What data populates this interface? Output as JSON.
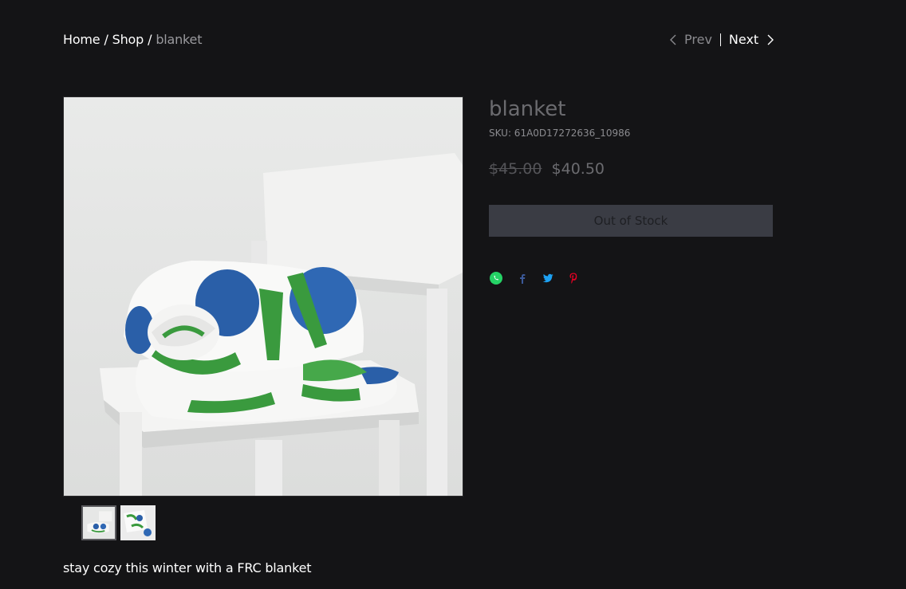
{
  "breadcrumb": {
    "home": "Home",
    "shop": "Shop",
    "current": "blanket",
    "separator": "/"
  },
  "pager": {
    "prev_label": "Prev",
    "next_label": "Next",
    "prev_icon": "chevron-left-icon",
    "next_icon": "chevron-right-icon"
  },
  "product": {
    "title": "blanket",
    "sku": "SKU: 61A0D17272636_10986",
    "original_price": "$45.00",
    "sale_price": "$40.50",
    "stock_button": "Out of Stock",
    "description": "stay cozy this winter with a FRC blanket"
  },
  "share": [
    {
      "name": "whatsapp-icon",
      "color": "#25D366"
    },
    {
      "name": "facebook-icon",
      "color": "#3b5998"
    },
    {
      "name": "twitter-icon",
      "color": "#1DA1F2"
    },
    {
      "name": "pinterest-icon",
      "color": "#E60023"
    }
  ],
  "colors": {
    "background": "#141416",
    "button_bg": "#3a3c44",
    "blanket_green": "#3a9a3e",
    "blanket_blue": "#2a5fa8"
  }
}
